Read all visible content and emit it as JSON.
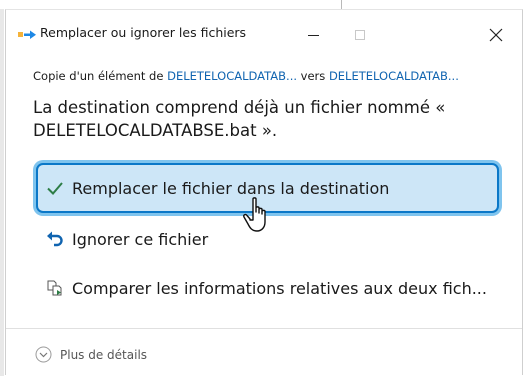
{
  "window": {
    "title": "Remplacer ou ignorer les fichiers"
  },
  "copy_info": {
    "prefix": "Copie d'un élément de ",
    "source": "DELETELOCALDATAB...",
    "middle": " vers ",
    "destination": "DELETELOCALDATAB..."
  },
  "message": "La destination comprend déjà un fichier nommé « DELETELOCALDATABSE.bat ».",
  "options": {
    "replace": "Remplacer le fichier dans la destination",
    "skip": "Ignorer ce fichier",
    "compare": "Comparer les informations relatives aux deux fich..."
  },
  "footer": {
    "more_details": "Plus de détails"
  },
  "colors": {
    "accent": "#0b78c8",
    "selection_fill": "#cde6f7",
    "link": "#1064b0",
    "check": "#2d7d46"
  },
  "icons": {
    "title": "copy-files-icon",
    "replace": "checkmark-icon",
    "skip": "undo-arrow-icon",
    "compare": "compare-files-icon",
    "details": "chevron-down-circle-icon",
    "pointer": "hand-pointer-icon"
  }
}
